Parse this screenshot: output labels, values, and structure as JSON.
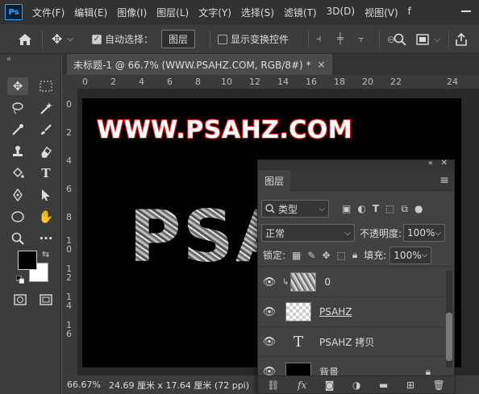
{
  "menubar": {
    "logo": "Ps",
    "items": [
      "文件(F)",
      "编辑(E)",
      "图像(I)",
      "图层(L)",
      "文字(Y)",
      "选择(S)",
      "滤镜(T)",
      "3D(D)",
      "视图(V)",
      "f"
    ]
  },
  "options": {
    "auto_select_label": "自动选择：",
    "auto_select_value": "图层",
    "show_transform_label": "显示变换控件"
  },
  "document": {
    "tab_title": "未标题-1 @ 66.7% (WWW.PSAHZ.COM, RGB/8#) *",
    "close": "×",
    "ruler_top": [
      "0",
      "2",
      "4",
      "6",
      "8",
      "10",
      "12",
      "14",
      "16",
      "18",
      "20",
      "22",
      "24"
    ],
    "ruler_left": [
      "0",
      "2",
      "4",
      "6",
      "8",
      "1\n0",
      "1\n2",
      "1\n4",
      "1\n6"
    ],
    "canvas_title": "WWW.PSAHZ.COM",
    "canvas_big": "PSA"
  },
  "status": {
    "zoom": "66.67%",
    "size": "24.69 厘米 x 17.64 厘米 (72 ppi)",
    "arrow": ">"
  },
  "layers_panel": {
    "tab": "图层",
    "filter_kind": "类型",
    "blend_mode": "正常",
    "opacity_label": "不透明度:",
    "opacity_value": "100%",
    "lock_label": "锁定:",
    "fill_label": "填充:",
    "fill_value": "100%",
    "layers": [
      {
        "name": "0",
        "thumb": "texture",
        "clipped": true
      },
      {
        "name": "PSAHZ",
        "thumb": "checker",
        "clipped": false
      },
      {
        "name": "PSAHZ 拷贝",
        "thumb": "type",
        "clipped": false
      },
      {
        "name": "背景",
        "thumb": "black",
        "clipped": false,
        "locked": true
      }
    ]
  }
}
